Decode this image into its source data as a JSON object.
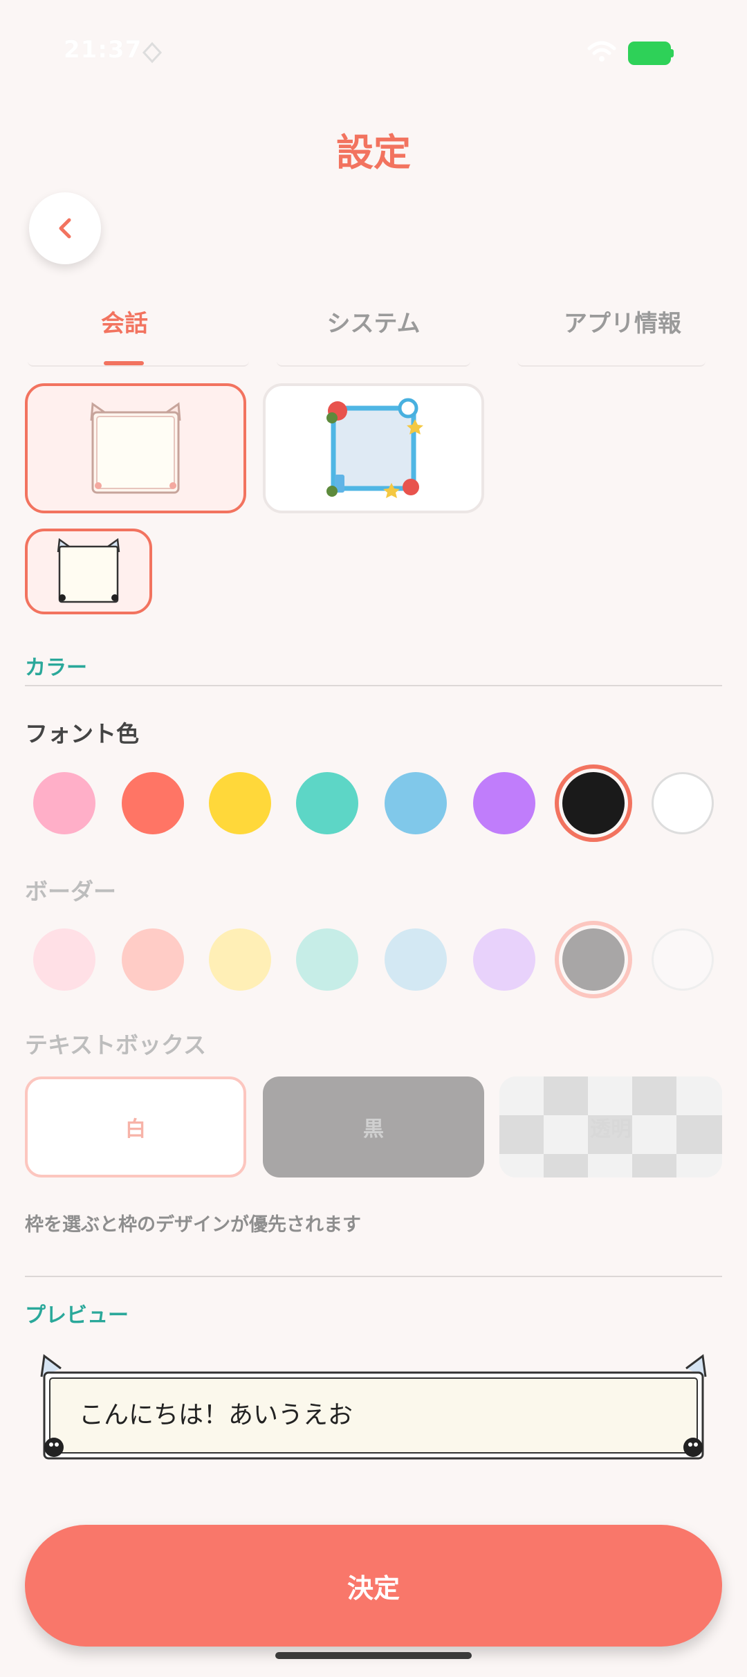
{
  "status": {
    "time": "21:37"
  },
  "header": {
    "title": "設定"
  },
  "tabs": [
    {
      "label": "会話",
      "active": true
    },
    {
      "label": "システム",
      "active": false
    },
    {
      "label": "アプリ情報",
      "active": false
    }
  ],
  "sections": {
    "color_label": "カラー",
    "font_color_label": "フォント色",
    "border_label": "ボーダー",
    "textbox_label": "テキストボックス",
    "preview_label": "プレビュー"
  },
  "font_colors": [
    "#ffafc8",
    "#ff7565",
    "#ffd83a",
    "#5dd6c6",
    "#80c8ea",
    "#c07dfb",
    "#1a1a1a",
    "#ffffff"
  ],
  "border_colors": [
    "#ffe0e6",
    "#ffccc6",
    "#ffefb6",
    "#c6ede7",
    "#d3e8f3",
    "#e8d2fb",
    "#a8a6a6",
    "#fbf8f8"
  ],
  "selected_font_color": "#1a1a1a",
  "textbox_options": [
    {
      "label": "白"
    },
    {
      "label": "黒"
    },
    {
      "label": "透明"
    }
  ],
  "note": "枠を選ぶと枠のデザインが優先されます",
  "preview": {
    "text": "こんにちは！あいうえお"
  },
  "confirm_label": "決定"
}
